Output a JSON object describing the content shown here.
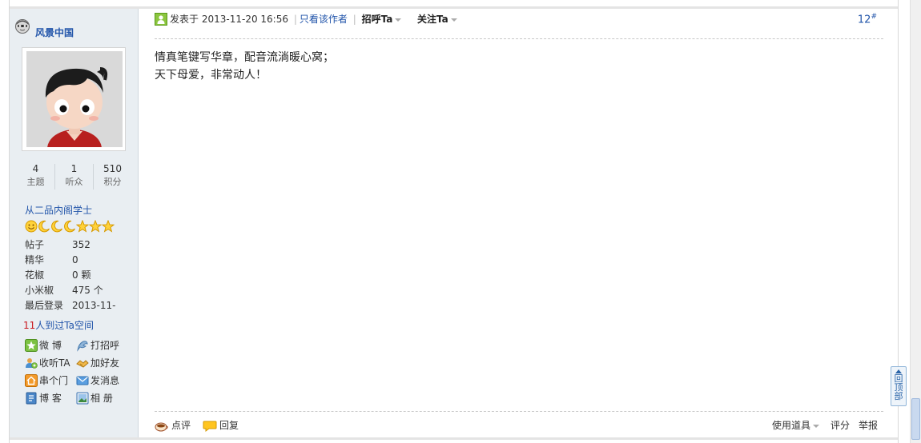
{
  "author": {
    "name": "风景中国",
    "stats": [
      {
        "value": "4",
        "label": "主题"
      },
      {
        "value": "1",
        "label": "听众"
      },
      {
        "value": "510",
        "label": "积分"
      }
    ],
    "rank": "从二品内阁学士",
    "rank_icons": [
      "smile-icon",
      "moon-icon",
      "moon-icon",
      "moon-icon",
      "star-icon",
      "star-icon",
      "star-icon"
    ],
    "profile": [
      {
        "key": "帖子",
        "value": "352"
      },
      {
        "key": "精华",
        "value": "0"
      },
      {
        "key": "花椒",
        "value": "0 颗"
      },
      {
        "key": "小米椒",
        "value": "475 个"
      },
      {
        "key": "最后登录",
        "value": "2013-11-"
      }
    ],
    "visitors_count": "11",
    "visitors_text": "人到过Ta空间",
    "actions": [
      {
        "icon": "weibo-icon",
        "label": "微 博"
      },
      {
        "icon": "greet-icon",
        "label": "打招呼"
      },
      {
        "icon": "follow-icon",
        "label": "收听TA"
      },
      {
        "icon": "add-friend-icon",
        "label": "加好友"
      },
      {
        "icon": "home-icon",
        "label": "串个门"
      },
      {
        "icon": "message-icon",
        "label": "发消息"
      },
      {
        "icon": "blog-icon",
        "label": "博 客"
      },
      {
        "icon": "album-icon",
        "label": "相 册"
      }
    ]
  },
  "post": {
    "meta_prefix": "发表于",
    "datetime": "2013-11-20 16:56",
    "only_author": "只看该作者",
    "greet": "招呼Ta",
    "follow": "关注Ta",
    "floor": "12",
    "floor_mark": "#",
    "body_lines": [
      "情真笔键写华章，配音流淌暖心窝；",
      "天下母爱，非常动人！"
    ]
  },
  "footer": {
    "rate": "点评",
    "reply": "回复",
    "tools": "使用道具",
    "score": "评分",
    "report": "举报"
  },
  "back_to_top": "回顶部",
  "colors": {
    "link": "#2255aa",
    "sidebar_bg": "#e9eef2",
    "visitor_count": "#c8161d"
  }
}
